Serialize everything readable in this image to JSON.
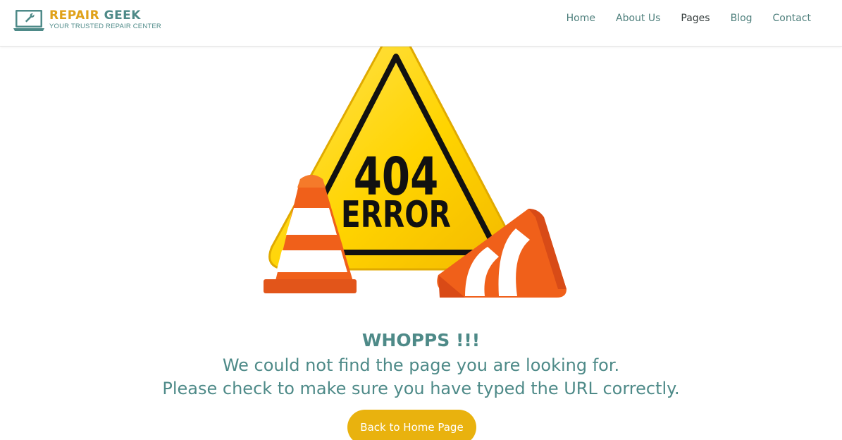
{
  "brand": {
    "name_part1": "REPAIR",
    "name_part2": "GEEK",
    "tagline": "YOUR TRUSTED REPAIR CENTER",
    "logo_icon": "laptop-wrench-icon",
    "colors": {
      "gold": "#e0a21a",
      "teal": "#4e8a88"
    }
  },
  "nav": {
    "items": [
      {
        "label": "Home"
      },
      {
        "label": "About Us"
      },
      {
        "label": "Pages",
        "active": true
      },
      {
        "label": "Blog"
      },
      {
        "label": "Contact"
      }
    ]
  },
  "illustration": {
    "sign_number": "404",
    "sign_word": "ERROR",
    "icon": "warning-sign-traffic-cones-icon"
  },
  "message": {
    "title": "WHOPPS !!!",
    "line1": "We could not find the page you are looking for.",
    "line2": "Please check to make sure you have typed the URL correctly."
  },
  "button": {
    "label": "Back to Home Page",
    "color": "#e9b20e"
  }
}
